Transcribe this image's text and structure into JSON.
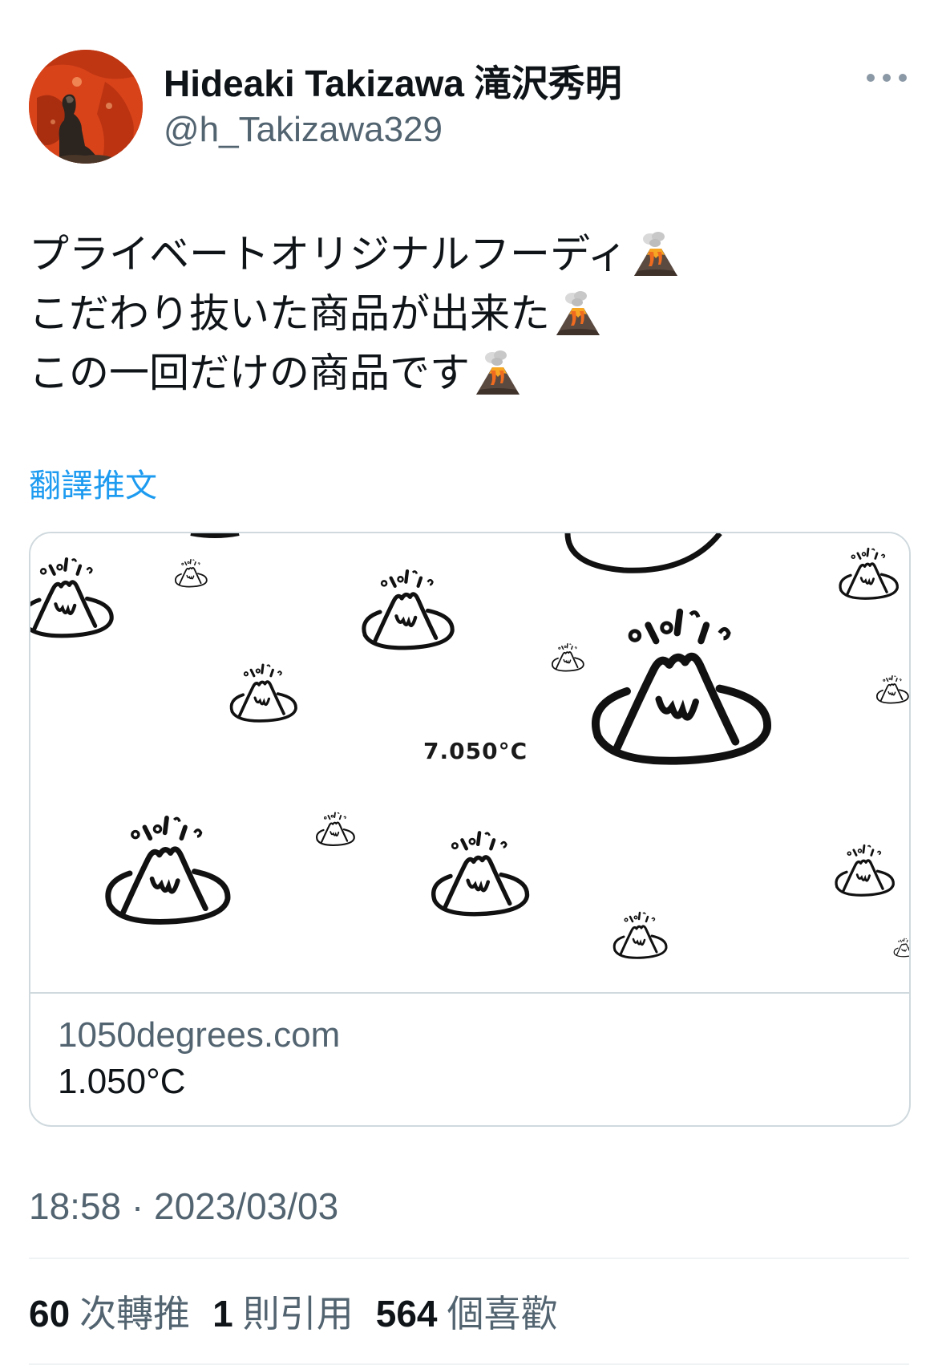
{
  "author": {
    "display_name": "Hideaki Takizawa 滝沢秀明",
    "handle": "@h_Takizawa329",
    "avatar": "profile-photo"
  },
  "more_icon": "more-horizontal-icon",
  "tweet": {
    "lines": [
      {
        "text": "プライベートオリジナルフーディ",
        "emoji": "volcano"
      },
      {
        "text": "こだわり抜いた商品が出来た",
        "emoji": "volcano"
      },
      {
        "text": "この一回だけの商品です",
        "emoji": "volcano"
      }
    ]
  },
  "translate_label": "翻譯推文",
  "card": {
    "image_text": "7.050°C",
    "domain": "1050degrees.com",
    "title": "1.050°C"
  },
  "timestamp": "18:58 · 2023/03/03",
  "stats": {
    "retweets": {
      "count": "60",
      "label": "次轉推"
    },
    "quotes": {
      "count": "1",
      "label": "則引用"
    },
    "likes": {
      "count": "564",
      "label": "個喜歡"
    }
  },
  "colors": {
    "text": "#0f1419",
    "secondary": "#536471",
    "link": "#1d9bf0",
    "border": "#cfd9de",
    "divider": "#eff3f4"
  }
}
